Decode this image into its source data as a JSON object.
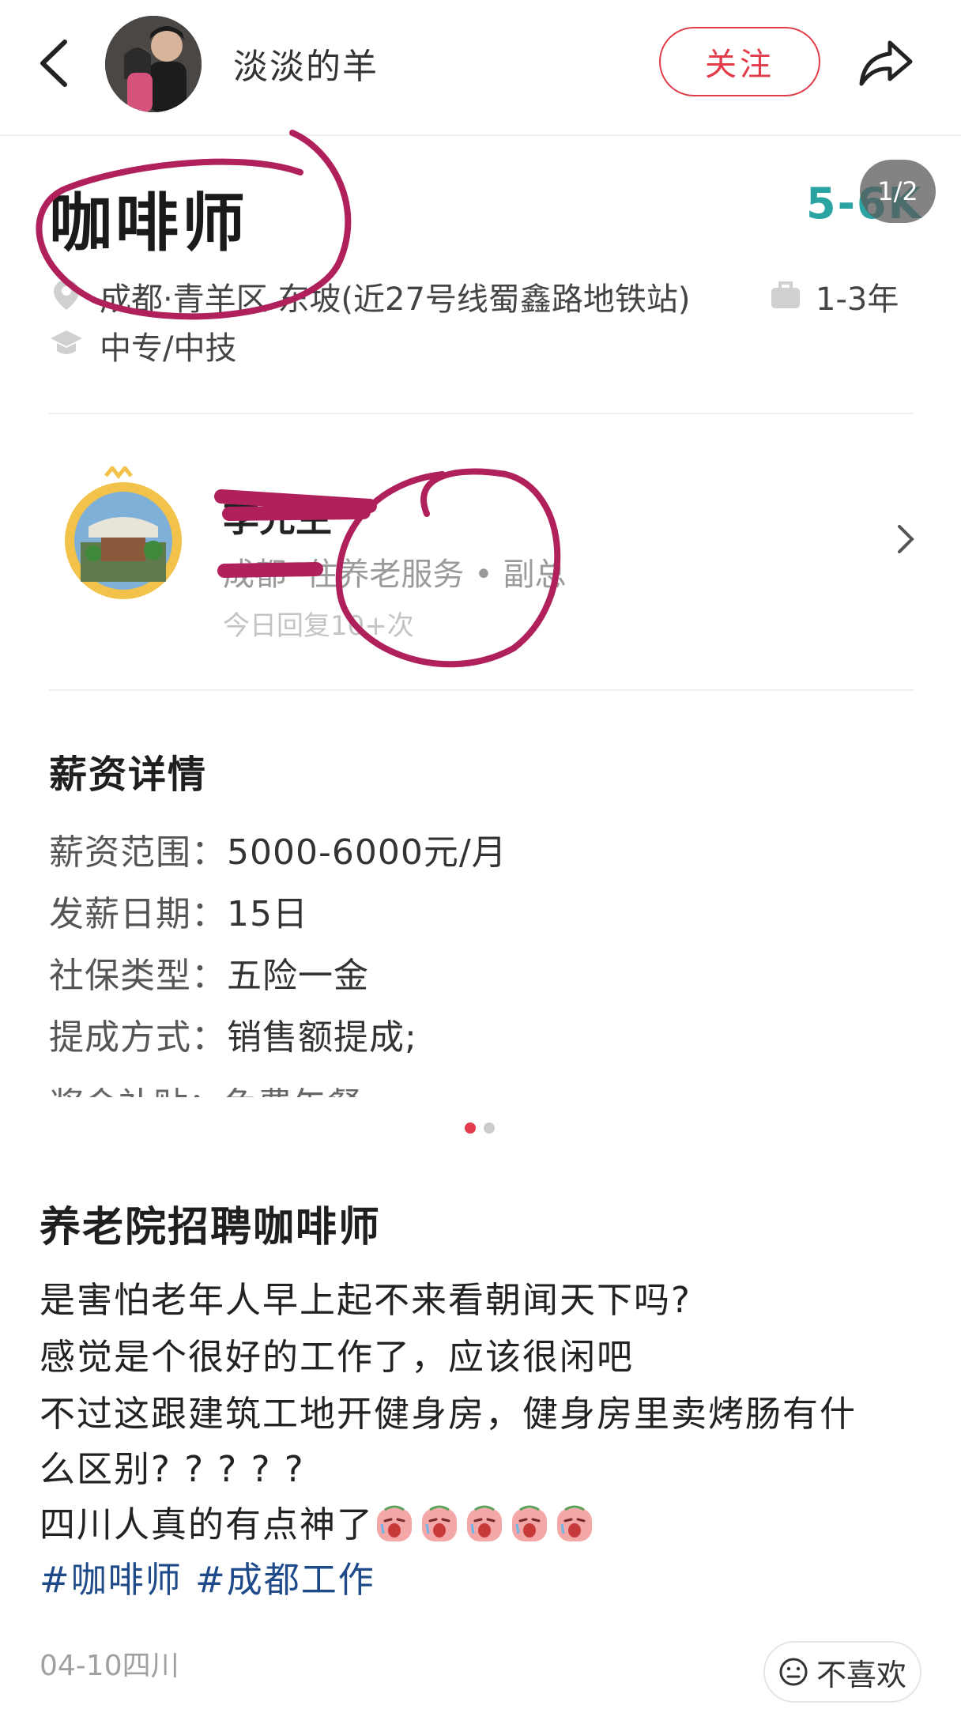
{
  "header": {
    "username": "淡淡的羊",
    "follow_label": "关注"
  },
  "job": {
    "title": "咖啡师",
    "salary": "5-6K",
    "pager": "1/2",
    "location": "成都·青羊区 东坡(近27号线蜀鑫路地铁站)",
    "experience": "1-3年",
    "education": "中专/中技"
  },
  "company": {
    "contact_name": "李先生",
    "company_and_role": "成都··住养老服务 • 副总",
    "reply_stat": "今日回复10+次"
  },
  "salary_details": {
    "section_title": "薪资详情",
    "rows": [
      {
        "label": "薪资范围：",
        "value": "5000-6000元/月"
      },
      {
        "label": "发薪日期：",
        "value": "15日"
      },
      {
        "label": "社保类型：",
        "value": "五险一金"
      },
      {
        "label": "提成方式：",
        "value": "销售额提成;"
      }
    ],
    "cutoff_row": "奖金补贴：免费午餐"
  },
  "carousel": {
    "total": 2,
    "active": 1
  },
  "post": {
    "title": "养老院招聘咖啡师",
    "lines": [
      "是害怕老年人早上起不来看朝闻天下吗?",
      "感觉是个很好的工作了，应该很闲吧",
      "不过这跟建筑工地开健身房，健身房里卖烤肠有什",
      "么区别? ? ? ? ?",
      "四川人真的有点神了"
    ],
    "emoji_count": 5,
    "hashtags": [
      "#咖啡师",
      "#成都工作"
    ],
    "date_location": "04-10四川",
    "dislike_label": "不喜欢"
  },
  "colors": {
    "accent_red": "#e23b4a",
    "salary_teal": "#2aa3a3",
    "hashtag_blue": "#1e4a8a",
    "annotation_magenta": "#b0205a"
  }
}
